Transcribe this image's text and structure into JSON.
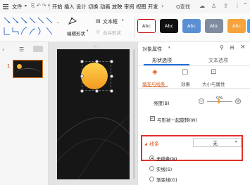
{
  "menu": {
    "file": "文件",
    "items": [
      "开始",
      "插入",
      "设计",
      "切换",
      "动画",
      "放映",
      "审阅",
      "视图",
      "开发"
    ],
    "search": "Q查找"
  },
  "toolbar": {
    "edit_shape": "编辑形状",
    "text_box": "文本框",
    "merge_shape": "合并形状",
    "styles": [
      {
        "label": "Abc",
        "bg": "#ffffff",
        "fg": "#333333",
        "border": "#c00000"
      },
      {
        "label": "Abc",
        "bg": "#111111",
        "fg": "#ffffff",
        "border": "#111111"
      },
      {
        "label": "Abc",
        "bg": "#5b8fd4",
        "fg": "#ffffff",
        "border": "#5b8fd4"
      },
      {
        "label": "Abc",
        "bg": "#7f8c9f",
        "fg": "#ffffff",
        "border": "#7f8c9f"
      },
      {
        "label": "Abc",
        "bg": "#f5a33a",
        "fg": "#ffffff",
        "border": "#f5a33a"
      },
      {
        "label": "Ab",
        "bg": "#4aa0e6",
        "fg": "#ffffff",
        "border": "#4aa0e6"
      }
    ]
  },
  "slides": {
    "number": "1"
  },
  "panel": {
    "title": "对象属性",
    "tab_shape": "形状选项",
    "tab_text": "文本选项",
    "sub_fill": "填充与线条",
    "sub_effect": "效果",
    "sub_size": "大小与属性",
    "transparency_label": "亮度(B)",
    "transparency_value": "0%",
    "rotate_with_shape": "与形状一起旋转(W)",
    "line_section": "线条",
    "line_value": "无",
    "opt_none": "无线条(N)",
    "opt_solid": "实线(S)",
    "opt_gradient": "渐变线(G)"
  },
  "colors": {
    "accent": "#1e6ed8",
    "highlight_box": "#e0302a",
    "sun_top": "#ffd24d",
    "sun_bottom": "#f39a1f"
  }
}
